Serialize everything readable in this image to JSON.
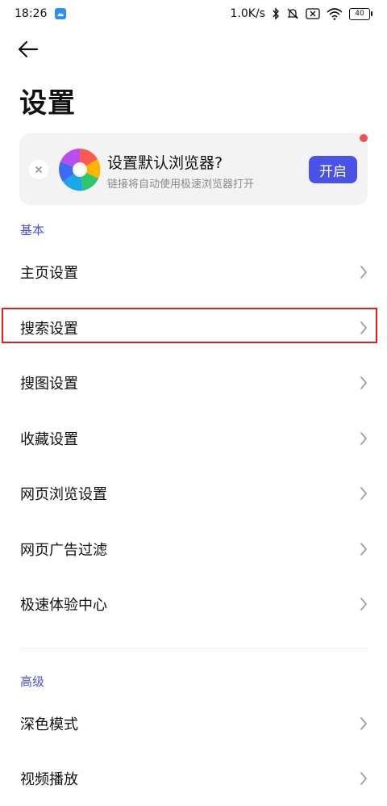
{
  "status_bar": {
    "time": "18:26",
    "app_icon": "gallery-app-icon",
    "net_speed": "1.0K/s",
    "icons": [
      "bluetooth-icon",
      "mute-icon",
      "sim-off-icon",
      "wifi-icon"
    ],
    "battery": "40"
  },
  "header": {
    "back_icon": "back-arrow-icon",
    "title": "设置"
  },
  "banner": {
    "close_icon": "close-icon",
    "logo_icon": "browser-logo-icon",
    "title": "设置默认浏览器?",
    "subtitle": "链接将自动使用极速浏览器打开",
    "open_button": "开启",
    "accent": "#4a51e6",
    "dot_color": "#f05050"
  },
  "sections": {
    "basic_label": "基本",
    "advanced_label": "高级"
  },
  "basic_items": [
    {
      "label": "主页设置"
    },
    {
      "label": "搜索设置"
    },
    {
      "label": "搜图设置"
    },
    {
      "label": "收藏设置"
    },
    {
      "label": "网页浏览设置"
    },
    {
      "label": "网页广告过滤"
    },
    {
      "label": "极速体验中心"
    }
  ],
  "advanced_items": [
    {
      "label": "深色模式"
    },
    {
      "label": "视频播放"
    }
  ],
  "highlight_color": "#e02020"
}
